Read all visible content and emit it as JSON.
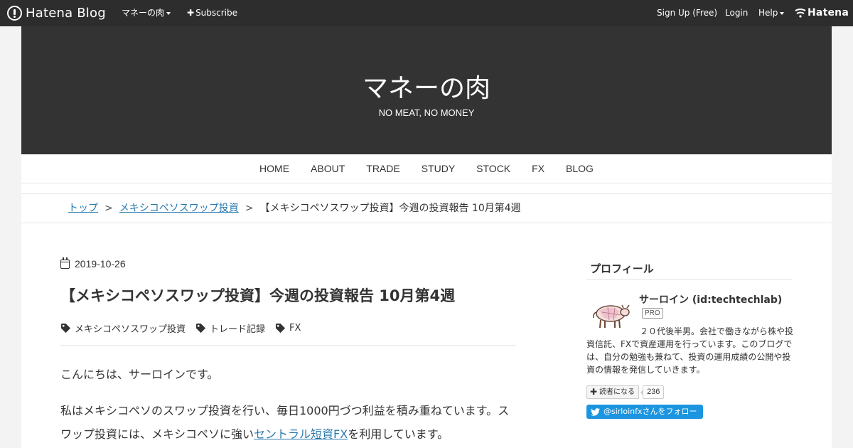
{
  "topbar": {
    "logo": "Hatena Blog",
    "blog_menu": "マネーの肉",
    "subscribe": "Subscribe",
    "signup": "Sign Up (Free)",
    "login": "Login",
    "help": "Help",
    "hatena": "Hatena"
  },
  "header": {
    "title": "マネーの肉",
    "description": "NO MEAT, NO MONEY"
  },
  "nav": [
    "HOME",
    "ABOUT",
    "TRADE",
    "STUDY",
    "STOCK",
    "FX",
    "BLOG"
  ],
  "breadcrumb": {
    "top": "トップ",
    "sep": ">",
    "category": "メキシコペソスワップ投資",
    "current": "【メキシコペソスワップ投資】今週の投資報告 10月第4週"
  },
  "entry": {
    "date": "2019-10-26",
    "title": "【メキシコペソスワップ投資】今週の投資報告 10月第4週",
    "categories": [
      "メキシコペソスワップ投資",
      "トレード記録",
      "FX"
    ],
    "p1": "こんにちは、サーロインです。",
    "p2_before": "私はメキシコペソのスワップ投資を行い、毎日1000円づつ利益を積み重ねています。スワップ投資には、メキシコペソに強い",
    "p2_link": "セントラル短資FX",
    "p2_after": "を利用しています。"
  },
  "sidebar": {
    "profile_title": "プロフィール",
    "name": "サーロイン (id:techtechlab)",
    "badge": "PRO",
    "description": "２０代後半男。会社で働きながら株や投資信託、FXで資産運用を行っています。このブログでは、自分の勉強も兼ねて、投資の運用成績の公開や投資の情報を発信していきます。",
    "subscribe_label": "読者になる",
    "subscriber_count": "236",
    "twitter_follow": "@sirloinfxさんをフォロー"
  },
  "colors": {
    "topbar_bg": "#2d2d2d",
    "header_bg": "#333333",
    "link": "#2a7ab0",
    "twitter": "#1b95e0"
  }
}
